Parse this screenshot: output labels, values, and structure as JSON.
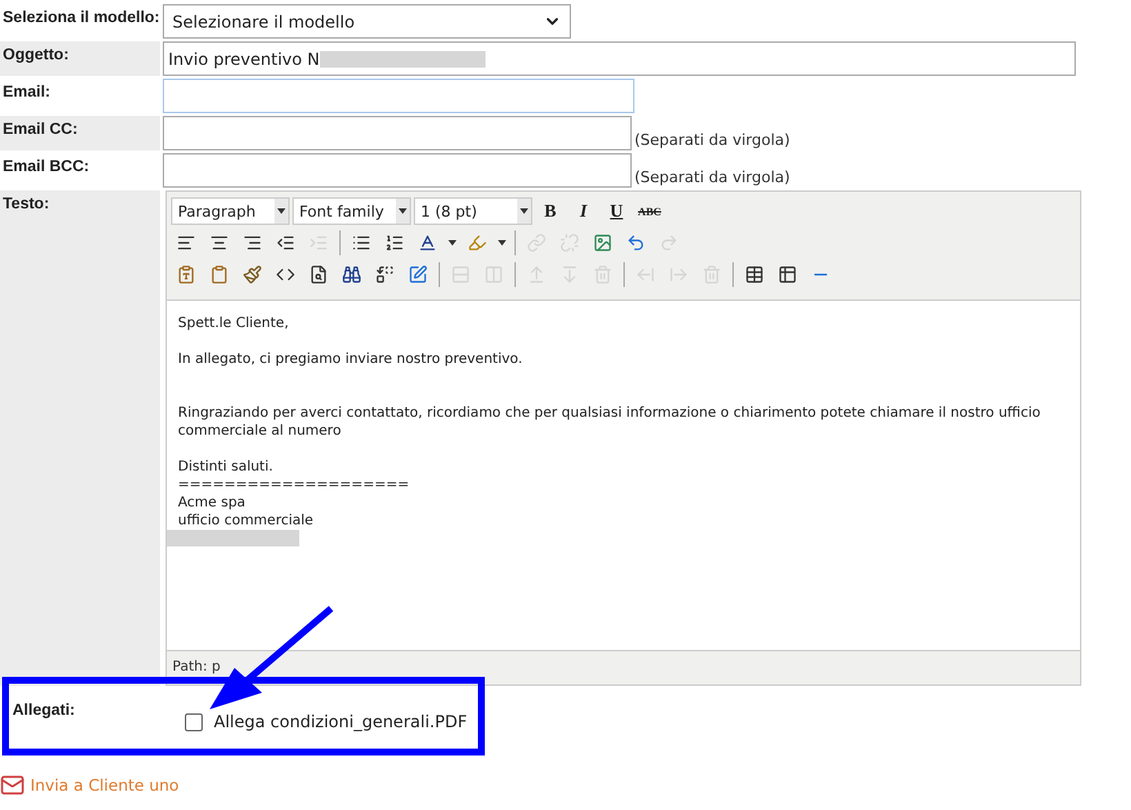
{
  "form": {
    "template": {
      "label": "Seleziona il modello:",
      "value": "Selezionare il modello"
    },
    "subject": {
      "label": "Oggetto:",
      "value": "Invio preventivo N"
    },
    "email": {
      "label": "Email:"
    },
    "cc": {
      "label": "Email CC:",
      "hint": "(Separati da virgola)"
    },
    "bcc": {
      "label": "Email BCC:",
      "hint": "(Separati da virgola)"
    },
    "body_label": "Testo:",
    "attachments": {
      "label": "Allegati:",
      "items": [
        {
          "name": "Allega condizioni_generali.PDF",
          "checked": false
        }
      ]
    }
  },
  "editor": {
    "selects": [
      {
        "value": "Paragraph"
      },
      {
        "value": "Font family"
      },
      {
        "value": "1 (8 pt)"
      }
    ],
    "format_buttons": [
      {
        "label": "B",
        "kind": "bold"
      },
      {
        "label": "I",
        "kind": "italic"
      },
      {
        "label": "U",
        "kind": "underline"
      },
      {
        "label": "ABC",
        "kind": "strike"
      }
    ],
    "toolbar_rows": [
      [
        {
          "kind": "align-left",
          "disabled": false
        },
        {
          "kind": "align-center",
          "disabled": false
        },
        {
          "kind": "align-right",
          "disabled": false
        },
        {
          "kind": "outdent",
          "disabled": false
        },
        {
          "kind": "indent",
          "disabled": true
        },
        {
          "kind": "separator"
        },
        {
          "kind": "bullet-list",
          "disabled": false
        },
        {
          "kind": "numbered-list",
          "disabled": false
        },
        {
          "kind": "font-color",
          "disabled": false
        },
        {
          "kind": "caret",
          "disabled": false
        },
        {
          "kind": "highlight",
          "disabled": false
        },
        {
          "kind": "caret",
          "disabled": false
        },
        {
          "kind": "separator"
        },
        {
          "kind": "link",
          "disabled": true
        },
        {
          "kind": "unlink",
          "disabled": true
        },
        {
          "kind": "image",
          "disabled": false
        },
        {
          "kind": "undo",
          "disabled": false
        },
        {
          "kind": "redo",
          "disabled": true
        }
      ],
      [
        {
          "kind": "paste-text",
          "disabled": false
        },
        {
          "kind": "paste-word",
          "disabled": false
        },
        {
          "kind": "cleanup",
          "disabled": false
        },
        {
          "kind": "html",
          "disabled": false
        },
        {
          "kind": "preview",
          "disabled": false
        },
        {
          "kind": "find",
          "disabled": false
        },
        {
          "kind": "replace",
          "disabled": false
        },
        {
          "kind": "edit",
          "disabled": false
        },
        {
          "kind": "separator"
        },
        {
          "kind": "row-props",
          "disabled": true
        },
        {
          "kind": "cell-props",
          "disabled": true
        },
        {
          "kind": "separator"
        },
        {
          "kind": "row-before",
          "disabled": true
        },
        {
          "kind": "row-after",
          "disabled": true
        },
        {
          "kind": "row-delete",
          "disabled": true
        },
        {
          "kind": "separator"
        },
        {
          "kind": "col-before",
          "disabled": true
        },
        {
          "kind": "col-after",
          "disabled": true
        },
        {
          "kind": "col-delete",
          "disabled": true
        },
        {
          "kind": "separator"
        },
        {
          "kind": "table",
          "disabled": false
        },
        {
          "kind": "table-alt",
          "disabled": false
        },
        {
          "kind": "rule",
          "disabled": false
        }
      ]
    ],
    "body": [
      {
        "kind": "text",
        "text": "Spett.le Cliente,"
      },
      {
        "kind": "blank"
      },
      {
        "kind": "text",
        "text": "In allegato, ci pregiamo inviare nostro preventivo."
      },
      {
        "kind": "blank"
      },
      {
        "kind": "blank"
      },
      {
        "kind": "text",
        "text": "Ringraziando per averci contattato, ricordiamo che per qualsiasi informazione o chiarimento potete chiamare il nostro ufficio commerciale al numero"
      },
      {
        "kind": "blank"
      },
      {
        "kind": "text",
        "text": "Distinti saluti."
      },
      {
        "kind": "text",
        "text": "===================="
      },
      {
        "kind": "text",
        "text": "Acme spa"
      },
      {
        "kind": "text",
        "text": "ufficio commerciale"
      },
      {
        "kind": "redacted"
      }
    ],
    "path": "Path: p"
  },
  "send_link": "Invia a Cliente uno"
}
